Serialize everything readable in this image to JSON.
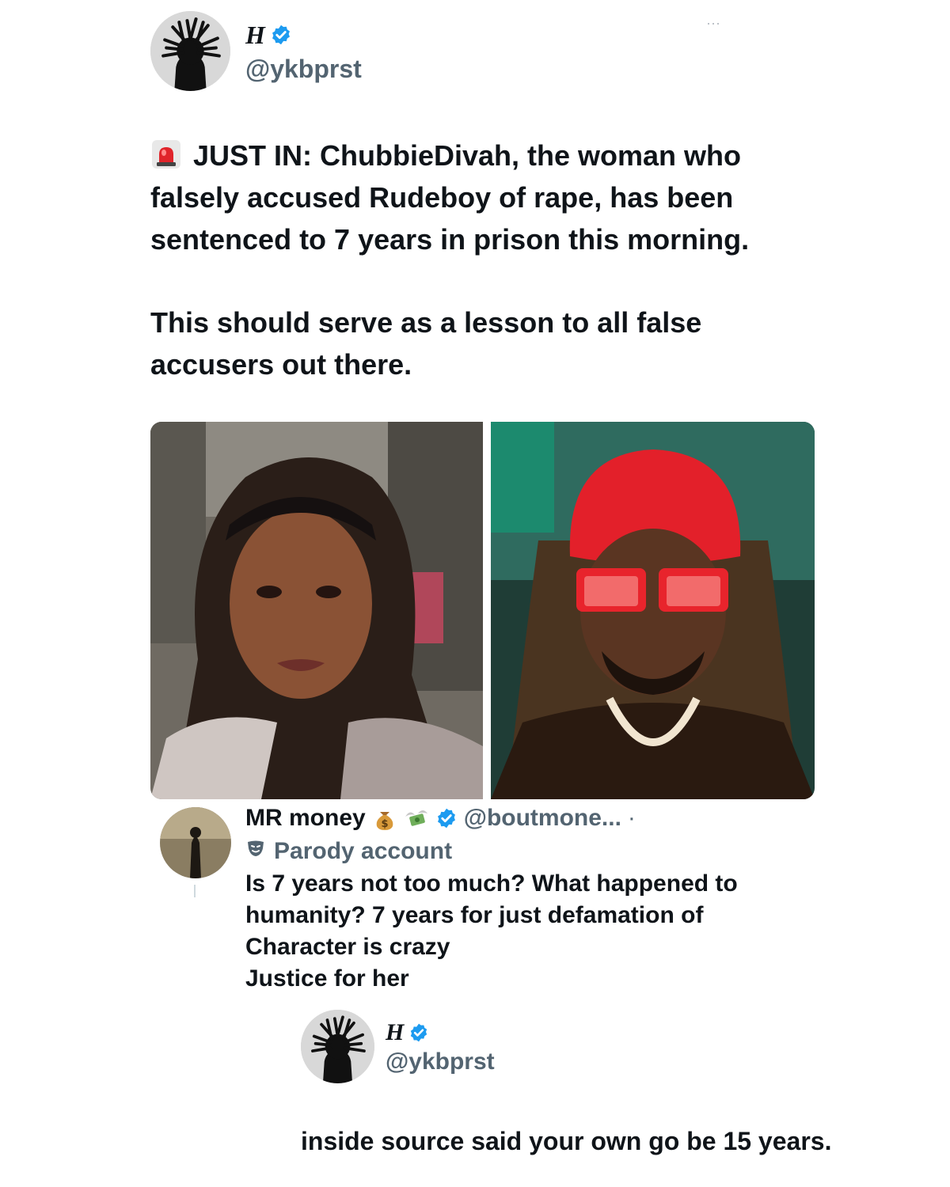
{
  "main_tweet": {
    "author_name": "H",
    "author_handle": "@ykbprst",
    "verified": true,
    "more_icon": "more-dots-icon",
    "body_line1_prefix_icon": "siren-emoji-icon",
    "body_paragraph1": "JUST IN: ChubbieDivah, the woman who falsely accused Rudeboy of rape, has been sentenced to 7 years in prison this morning.",
    "body_paragraph2": "This should serve as a lesson to all false accusers out there.",
    "media": [
      {
        "name": "photo-woman-in-hijab"
      },
      {
        "name": "photo-man-red-cap-sunglasses"
      }
    ]
  },
  "reply": {
    "author_name": "MR money",
    "author_emojis": [
      "money-bag-icon",
      "money-with-wings-icon"
    ],
    "verified": true,
    "author_handle": "@boutmone...",
    "separator": "·",
    "parody_label": "Parody account",
    "parody_icon": "mask-icon",
    "text_lines": [
      "Is 7 years not too much? What happened to",
      "humanity? 7 years for just defamation of",
      "Character is crazy",
      "Justice for her"
    ]
  },
  "quote_reply": {
    "author_name": "H",
    "author_handle": "@ykbprst",
    "verified": true,
    "text": "inside source said your own go be 15 years."
  },
  "colors": {
    "text": "#0f1419",
    "secondary": "#536471",
    "verified_blue": "#1d9bf0"
  }
}
